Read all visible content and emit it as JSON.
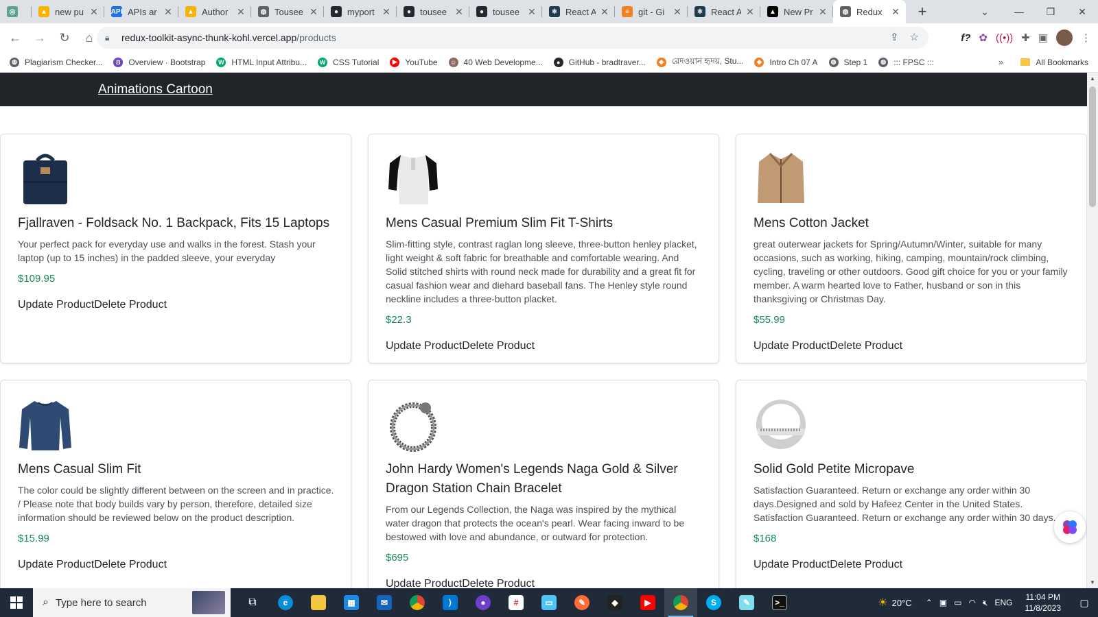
{
  "browser": {
    "tabs": [
      {
        "title": "",
        "icon_color": "#5ba38d",
        "glyph": "◎"
      },
      {
        "title": "new pu",
        "icon_color": "#f4b400",
        "glyph": "▲"
      },
      {
        "title": "APIs ar",
        "icon_color": "#1a73e8",
        "glyph": "API"
      },
      {
        "title": "Author",
        "icon_color": "#f4b400",
        "glyph": "▲"
      },
      {
        "title": "Tousee",
        "icon_color": "#5f6368",
        "glyph": "◍"
      },
      {
        "title": "myport",
        "icon_color": "#24292f",
        "glyph": "●"
      },
      {
        "title": "tousee",
        "icon_color": "#24292f",
        "glyph": "●"
      },
      {
        "title": "tousee",
        "icon_color": "#24292f",
        "glyph": "●"
      },
      {
        "title": "React A",
        "icon_color": "#1f3b4d",
        "glyph": "⚛"
      },
      {
        "title": "git - Gi",
        "icon_color": "#f48024",
        "glyph": "≡"
      },
      {
        "title": "React A",
        "icon_color": "#1f3b4d",
        "glyph": "⚛"
      },
      {
        "title": "New Pr",
        "icon_color": "#000000",
        "glyph": "▲"
      },
      {
        "title": "Redux",
        "icon_color": "#5f6368",
        "glyph": "◍"
      }
    ],
    "url_host": "redux-toolkit-async-thunk-kohl.vercel.app",
    "url_path": "/products",
    "bookmarks": [
      {
        "label": "Plagiarism Checker...",
        "color": "#5f6368",
        "glyph": "◍"
      },
      {
        "label": "Overview · Bootstrap",
        "color": "#6f42c1",
        "glyph": "B"
      },
      {
        "label": "HTML Input Attribu...",
        "color": "#04aa6d",
        "glyph": "W"
      },
      {
        "label": "CSS Tutorial",
        "color": "#04aa6d",
        "glyph": "W"
      },
      {
        "label": "YouTube",
        "color": "#ff0000",
        "glyph": "▶"
      },
      {
        "label": "40 Web Developme...",
        "color": "#8d6e63",
        "glyph": "☺"
      },
      {
        "label": "GitHub - bradtraver...",
        "color": "#24292f",
        "glyph": "●"
      },
      {
        "label": "রেদওয়ান হৃদয়, Stu...",
        "color": "#f48024",
        "glyph": "◆"
      },
      {
        "label": "Intro Ch 07 A",
        "color": "#f48024",
        "glyph": "◆"
      },
      {
        "label": "Step 1",
        "color": "#5f6368",
        "glyph": "◍"
      },
      {
        "label": "::: FPSC :::",
        "color": "#5f6368",
        "glyph": "◍"
      }
    ],
    "bookmarks_more": "»",
    "all_bookmarks": "All Bookmarks"
  },
  "page": {
    "brand": "Animations Cartoon",
    "update_label": "Update Product",
    "delete_label": "Delete Product",
    "products": [
      {
        "title": "Fjallraven - Foldsack No. 1 Backpack, Fits 15 Laptops",
        "description": "Your perfect pack for everyday use and walks in the forest. Stash your laptop (up to 15 inches) in the padded sleeve, your everyday",
        "price": "$109.95",
        "image": "backpack"
      },
      {
        "title": "Mens Casual Premium Slim Fit T-Shirts",
        "description": "Slim-fitting style, contrast raglan long sleeve, three-button henley placket, light weight & soft fabric for breathable and comfortable wearing. And Solid stitched shirts with round neck made for durability and a great fit for casual fashion wear and diehard baseball fans. The Henley style round neckline includes a three-button placket.",
        "price": "$22.3",
        "image": "tshirt"
      },
      {
        "title": "Mens Cotton Jacket",
        "description": "great outerwear jackets for Spring/Autumn/Winter, suitable for many occasions, such as working, hiking, camping, mountain/rock climbing, cycling, traveling or other outdoors. Good gift choice for you or your family member. A warm hearted love to Father, husband or son in this thanksgiving or Christmas Day.",
        "price": "$55.99",
        "image": "jacket"
      },
      {
        "title": "Mens Casual Slim Fit",
        "description": "The color could be slightly different between on the screen and in practice. / Please note that body builds vary by person, therefore, detailed size information should be reviewed below on the product description.",
        "price": "$15.99",
        "image": "longsleeve"
      },
      {
        "title": "John Hardy Women's Legends Naga Gold & Silver Dragon Station Chain Bracelet",
        "description": "From our Legends Collection, the Naga was inspired by the mythical water dragon that protects the ocean's pearl. Wear facing inward to be bestowed with love and abundance, or outward for protection.",
        "price": "$695",
        "image": "bracelet"
      },
      {
        "title": "Solid Gold Petite Micropave",
        "description": "Satisfaction Guaranteed. Return or exchange any order within 30 days.Designed and sold by Hafeez Center in the United States. Satisfaction Guaranteed. Return or exchange any order within 30 days.",
        "price": "$168",
        "image": "ring"
      }
    ]
  },
  "taskbar": {
    "search_placeholder": "Type here to search",
    "weather": "20°C",
    "language": "ENG",
    "time": "11:04 PM",
    "date": "11/8/2023"
  }
}
